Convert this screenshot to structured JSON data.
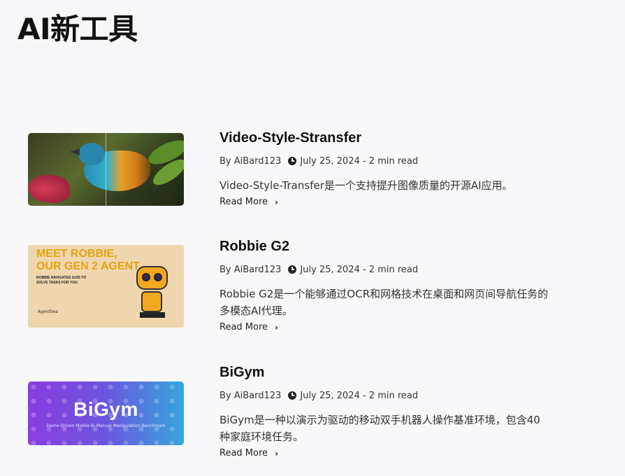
{
  "page": {
    "title": "AI新工具"
  },
  "posts": [
    {
      "title": "Video-Style-Stransfer",
      "author": "By AiBard123",
      "date": "July 25, 2024 - 2 min read",
      "excerpt": "Video-Style-Transfer是一个支持提升图像质量的开源AI应用。",
      "read_more": "Read More",
      "thumbnail": "bird-image"
    },
    {
      "title": "Robbie G2",
      "author": "By AiBard123",
      "date": "July 25, 2024 - 2 min read",
      "excerpt": "Robbie G2是一个能够通过OCR和网格技术在桌面和网页间导航任务的多模态AI代理。",
      "read_more": "Read More",
      "thumbnail": "robbie-image",
      "thumb_text": {
        "headline": "MEET ROBBIE, OUR GEN 2 AGENT",
        "tagline": "ROBBIE NAVIGATES GUIS TO SOLVE TASKS FOR YOU.",
        "logo": "AgentSea"
      }
    },
    {
      "title": "BiGym",
      "author": "By AiBard123",
      "date": "July 25, 2024 - 2 min read",
      "excerpt": "BiGym是一种以演示为驱动的移动双手机器人操作基准环境，包含40种家庭环境任务。",
      "read_more": "Read More",
      "thumbnail": "bigym-image",
      "thumb_text": {
        "headline": "BiGym",
        "tagline": "Demo-Driven Mobile Bi-Manual Manipulation Benchmark"
      }
    }
  ],
  "icons": {
    "clock": "clock-icon",
    "chevron": "chevron-right-icon"
  },
  "colors": {
    "background": "#f8f8fa",
    "text": "#1a1a1a",
    "accent_robbie": "#e3a414"
  }
}
